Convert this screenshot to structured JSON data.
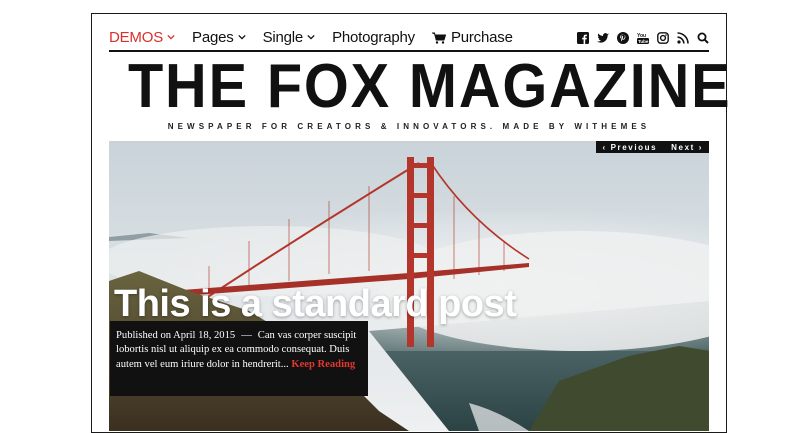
{
  "nav": {
    "items": [
      {
        "label": "DEMOS",
        "active": true,
        "has_dropdown": true
      },
      {
        "label": "Pages",
        "active": false,
        "has_dropdown": true
      },
      {
        "label": "Single",
        "active": false,
        "has_dropdown": true
      },
      {
        "label": "Photography",
        "active": false,
        "has_dropdown": false
      },
      {
        "label": "Purchase",
        "active": false,
        "has_dropdown": false,
        "icon": "cart-icon"
      }
    ],
    "social_icons": [
      "facebook-icon",
      "twitter-icon",
      "pinterest-icon",
      "youtube-icon",
      "instagram-icon",
      "rss-icon",
      "search-icon"
    ]
  },
  "masthead": {
    "title": "THE FOX MAGAZINE",
    "tagline": "NEWSPAPER FOR CREATORS & INNOVATORS. MADE BY WITHEMES"
  },
  "slider": {
    "prev_label": "‹ Previous",
    "next_label": "Next ›"
  },
  "post": {
    "title": "This is a standard post",
    "published": "Published on April 18, 2015",
    "dash": "—",
    "excerpt": "Can vas corper suscipit lobortis nisl ut aliquip ex ea commodo consequat. Duis autem vel eum iriure dolor in hendrerit...",
    "read_more": "Keep Reading"
  },
  "colors": {
    "accent": "#d9302c",
    "text": "#111111",
    "bridge": "#b4352b"
  }
}
